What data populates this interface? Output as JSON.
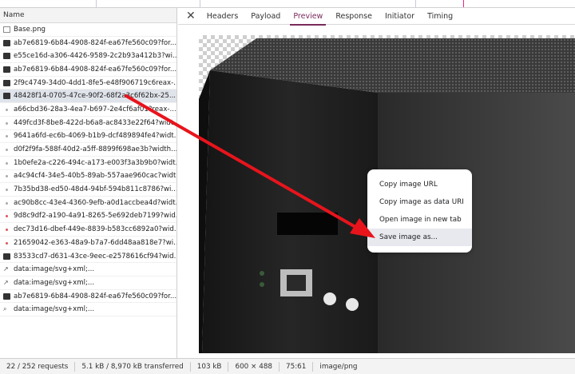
{
  "list": {
    "header": "Name",
    "rows": [
      {
        "name": "Base.png",
        "icon": "file-icon"
      },
      {
        "name": "ab7e6819-6b84-4908-824f-ea67fe560c09?for...",
        "icon": "image-icon"
      },
      {
        "name": "e55ce16d-a306-4426-9589-2c2b93a412b3?wi...",
        "icon": "image-icon"
      },
      {
        "name": "ab7e6819-6b84-4908-824f-ea67fe560c09?for...",
        "icon": "image-icon"
      },
      {
        "name": "2f9c4749-34d0-4dd1-8fe5-e48f906719c6reax-...",
        "icon": "image-icon"
      },
      {
        "name": "48428f14-0705-47ce-90f2-68f2a3c6f62bx-25...",
        "icon": "image-icon"
      },
      {
        "name": "a66cbd36-28a3-4ea7-b697-2e4cf6af01?reax-...",
        "icon": "dot-icon"
      },
      {
        "name": "449fcd3f-8be8-422d-b6a8-ac8433e22f64?widt...",
        "icon": "dot-icon"
      },
      {
        "name": "9641a6fd-ec6b-4069-b1b9-dcf489894fe4?widt...",
        "icon": "dot-icon"
      },
      {
        "name": "d0f2f9fa-588f-40d2-a5ff-8899f698ae3b?width...",
        "icon": "dot-icon"
      },
      {
        "name": "1b0efe2a-c226-494c-a173-e003f3a3b9b0?widt...",
        "icon": "dot-icon"
      },
      {
        "name": "a4c94cf4-34e5-40b5-89ab-557aae960cac?widt...",
        "icon": "dot-icon"
      },
      {
        "name": "7b35bd38-ed50-48d4-94bf-594b811c8786?wi...",
        "icon": "dot-icon"
      },
      {
        "name": "ac90b8cc-43e4-4360-9efb-a0d1accbea4d?widt...",
        "icon": "dot-icon"
      },
      {
        "name": "9d8c9df2-a190-4a91-8265-5e692deb7199?wid...",
        "icon": "red-dot-icon"
      },
      {
        "name": "dec73d16-dbef-449e-8839-b583cc6892a0?wid...",
        "icon": "red-dot-icon"
      },
      {
        "name": "21659042-e363-48a9-b7a7-6dd48aa818e7?wi...",
        "icon": "red-dot-icon"
      },
      {
        "name": "83533cd7-d631-43ce-9eec-e2578616cf94?wid...",
        "icon": "image-icon"
      },
      {
        "name": "data:image/svg+xml;...",
        "icon": "svg-icon"
      },
      {
        "name": "data:image/svg+xml;...",
        "icon": "svg-icon"
      },
      {
        "name": "ab7e6819-6b84-4908-824f-ea67fe560c09?for...",
        "icon": "image-icon"
      },
      {
        "name": "data:image/svg+xml;...",
        "icon": "search-icon"
      }
    ]
  },
  "tabs": [
    "Headers",
    "Payload",
    "Preview",
    "Response",
    "Initiator",
    "Timing"
  ],
  "active_tab": "Preview",
  "context_menu": [
    "Copy image URL",
    "Copy image as data URI",
    "Open image in new tab",
    "Save image as..."
  ],
  "status": {
    "requests": "22 / 252 requests",
    "transferred": "5.1 kB / 8,970 kB transferred",
    "size": "103 kB",
    "dimensions": "600 × 488",
    "ratio": "75:61",
    "mime": "image/png"
  },
  "colors": {
    "arrow": "#e8141c",
    "active_tab": "#7a2a5a",
    "device_body": "#1c1c1c"
  }
}
